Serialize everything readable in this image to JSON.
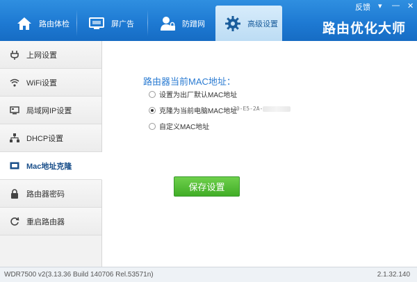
{
  "window_controls": {
    "feedback": "反馈",
    "menu": "▾",
    "minimize": "—",
    "close": "✕"
  },
  "brand": "路由优化大师",
  "tabs": [
    {
      "label": "路由体检",
      "icon": "house-icon"
    },
    {
      "label": "屏广告",
      "icon": "monitor-icon"
    },
    {
      "label": "防蹭网",
      "icon": "user-lock-icon"
    },
    {
      "label": "高级设置",
      "icon": "gear-icon",
      "active": true
    }
  ],
  "sidebar": {
    "items": [
      {
        "label": "上网设置",
        "icon": "plug-icon"
      },
      {
        "label": "WiFi设置",
        "icon": "wifi-icon"
      },
      {
        "label": "局域网IP设置",
        "icon": "lan-icon"
      },
      {
        "label": "DHCP设置",
        "icon": "network-tree-icon"
      },
      {
        "label": "Mac地址克隆",
        "icon": "mac-card-icon",
        "active": true
      },
      {
        "label": "路由器密码",
        "icon": "lock-icon"
      },
      {
        "label": "重启路由器",
        "icon": "refresh-icon"
      }
    ]
  },
  "main": {
    "section_title": "路由器当前MAC地址：",
    "options": [
      {
        "label": "设置为出厂默认MAC地址",
        "checked": false
      },
      {
        "label": "克隆为当前电脑MAC地址",
        "checked": true
      },
      {
        "label": "自定义MAC地址",
        "checked": false
      }
    ],
    "current_pc_mac": "20-E5-2A-",
    "save_label": "保存设置"
  },
  "status": {
    "firmware": "WDR7500 v2(3.13.36 Build 140706 Rel.53571n)",
    "version": "2.1.32.140"
  },
  "colors": {
    "topbar": "#1e7ad3",
    "accent": "#2a7bd2",
    "save_button": "#4cb830"
  }
}
